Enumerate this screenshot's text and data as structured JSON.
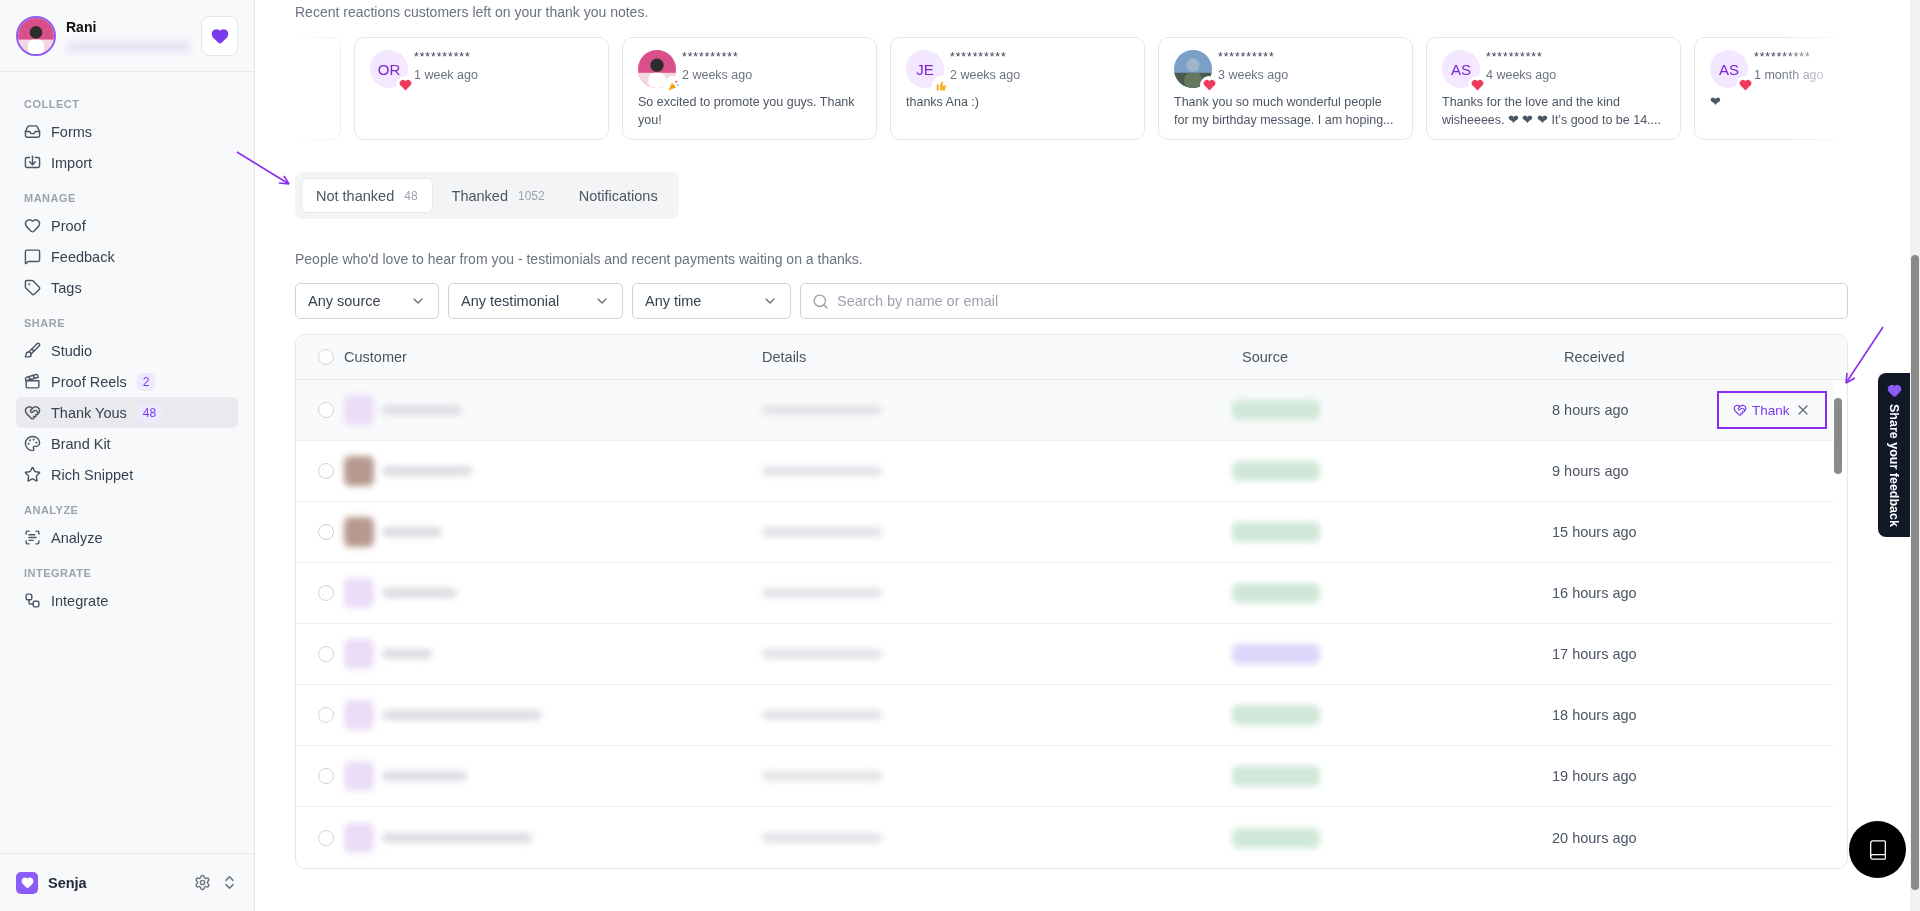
{
  "user": {
    "name": "Rani"
  },
  "sidebar": {
    "sections": [
      {
        "title": "COLLECT",
        "items": [
          {
            "label": "Forms",
            "selected": false
          },
          {
            "label": "Import",
            "selected": false
          }
        ]
      },
      {
        "title": "MANAGE",
        "items": [
          {
            "label": "Proof",
            "selected": false
          },
          {
            "label": "Feedback",
            "selected": false
          },
          {
            "label": "Tags",
            "selected": false
          }
        ]
      },
      {
        "title": "SHARE",
        "items": [
          {
            "label": "Studio",
            "selected": false
          },
          {
            "label": "Proof Reels",
            "badge": "2",
            "selected": false
          },
          {
            "label": "Thank Yous",
            "badge": "48",
            "selected": true
          },
          {
            "label": "Brand Kit",
            "selected": false
          },
          {
            "label": "Rich Snippet",
            "selected": false
          }
        ]
      },
      {
        "title": "ANALYZE",
        "items": [
          {
            "label": "Analyze",
            "selected": false
          }
        ]
      },
      {
        "title": "INTEGRATE",
        "items": [
          {
            "label": "Integrate",
            "selected": false
          }
        ]
      }
    ],
    "workspace": "Senja"
  },
  "reactions": {
    "intro": "Recent reactions customers left on your thank you notes.",
    "cards": [
      {
        "kind": "initials",
        "initials": "OR",
        "name": "**********",
        "time": "1 week ago"
      },
      {
        "name": "**********",
        "time": "2 weeks ago",
        "message": "So excited to promote you guys. Thank you!"
      },
      {
        "kind": "initials",
        "initials": "JE",
        "name": "**********",
        "time": "2 weeks ago",
        "message": "thanks Ana :)"
      },
      {
        "name": "**********",
        "time": "3 weeks ago",
        "message": "Thank you so much wonderful people for my birthday message. I am hoping..."
      },
      {
        "kind": "initials",
        "initials": "AS",
        "name": "**********",
        "time": "4 weeks ago",
        "message": "Thanks for the love and the kind wisheeees. ❤ ❤ ❤  It’s good to be 14...."
      },
      {
        "kind": "initials",
        "initials": "AS",
        "name": "**********",
        "time": "1 month ago",
        "message": "❤"
      }
    ]
  },
  "tabs": [
    {
      "label": "Not thanked",
      "count": "48",
      "selected": true
    },
    {
      "label": "Thanked",
      "count": "1052",
      "selected": false
    },
    {
      "label": "Notifications",
      "selected": false
    }
  ],
  "description": "People who'd love to hear from you - testimonials and recent payments waiting on a thanks.",
  "filters": [
    "Any source",
    "Any testimonial",
    "Any time"
  ],
  "search": {
    "placeholder": "Search by name or email"
  },
  "table": {
    "select_all_checked": false,
    "columns": [
      "Customer",
      "Details",
      "Source",
      "Received"
    ],
    "rows": [
      {
        "kind": "initials",
        "color": "#cfe8d8",
        "received": "8 hours ago",
        "checked": false,
        "hovered": true
      },
      {
        "color": "#cfe8d8",
        "received": "9 hours ago",
        "checked": false,
        "hovered": false
      },
      {
        "color": "#cfe8d8",
        "received": "15 hours ago",
        "checked": false,
        "hovered": false
      },
      {
        "kind": "initials",
        "color": "#cfe8d8",
        "received": "16 hours ago",
        "checked": false,
        "hovered": false
      },
      {
        "kind": "initials",
        "color": "#ddd6fb",
        "received": "17 hours ago",
        "checked": false,
        "hovered": false
      },
      {
        "kind": "initials",
        "color": "#cfe8d8",
        "received": "18 hours ago",
        "checked": false,
        "hovered": false
      },
      {
        "kind": "initials",
        "color": "#cfe8d8",
        "received": "19 hours ago",
        "checked": false,
        "hovered": false
      },
      {
        "kind": "initials",
        "color": "#cfe8d8",
        "received": "20 hours ago",
        "checked": false,
        "hovered": false
      }
    ],
    "thank_button": "Thank"
  },
  "feedback_tab": "Share your feedback"
}
